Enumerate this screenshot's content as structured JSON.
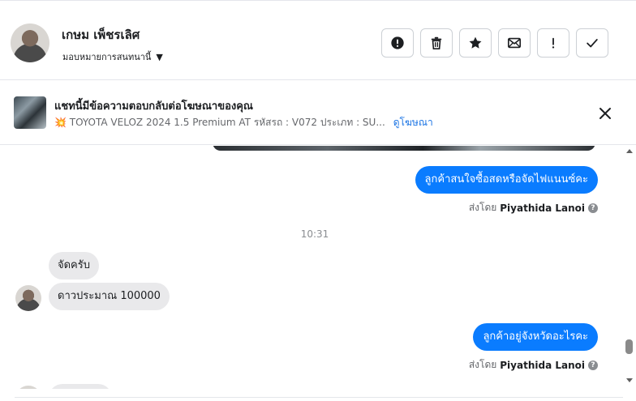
{
  "header": {
    "name": "เกษม เพ็ชรเลิศ",
    "assign_label": "มอบหมายการสนทนานี้",
    "actions": [
      {
        "name": "spam-button",
        "icon": "exclamation-circle-icon"
      },
      {
        "name": "delete-button",
        "icon": "trash-icon"
      },
      {
        "name": "star-button",
        "icon": "star-icon"
      },
      {
        "name": "mark-unread-button",
        "icon": "envelope-icon"
      },
      {
        "name": "follow-up-button",
        "icon": "exclamation-icon"
      },
      {
        "name": "mark-done-button",
        "icon": "check-icon"
      }
    ]
  },
  "ad_banner": {
    "title": "แชทนี้มีข้อความตอบกลับต่อโฆษณาของคุณ",
    "subtitle": "💥 TOYOTA VELOZ 2024 1.5 Premium AT รหัสรถ : V072 ประเภท : SU...",
    "link_label": "ดูโฆษณา"
  },
  "messages": {
    "out1": "ลูกค้าสนใจซื้อสดหรือจัดไฟแนนซ์คะ",
    "sent_by_prefix": "ส่งโดย",
    "sent_by_name": "Piyathida Lanoi",
    "timestamp": "10:31",
    "in1": "จัดครับ",
    "in2": "ดาวประมาณ 100000",
    "out2": "ลูกค้าอยู่จังหวัดอะไรคะ"
  },
  "colors": {
    "outgoing_bubble": "#0a7cff",
    "incoming_bubble": "#e9e9eb",
    "link": "#1b74e4"
  }
}
